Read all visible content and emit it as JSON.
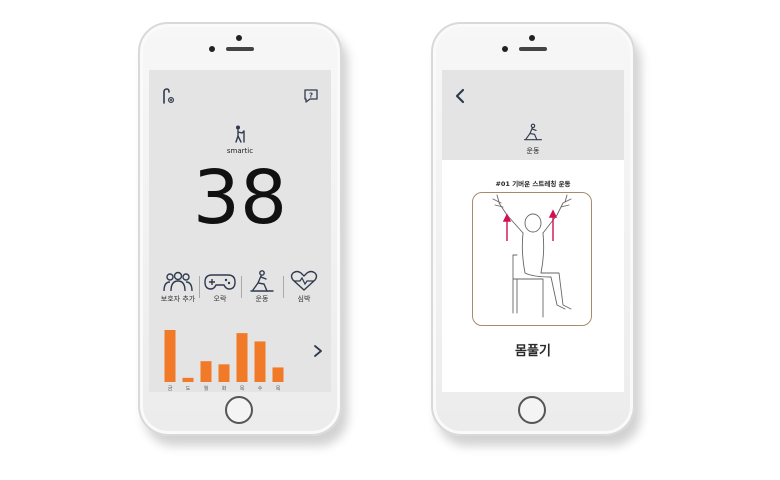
{
  "left_screen": {
    "brand_label": "smartic",
    "main_value": "38",
    "menu": [
      {
        "label": "보호자 추가",
        "icon": "people-icon"
      },
      {
        "label": "오락",
        "icon": "gamepad-icon"
      },
      {
        "label": "운동",
        "icon": "exercise-icon"
      },
      {
        "label": "심박",
        "icon": "heart-rate-icon"
      }
    ],
    "chart_data": {
      "type": "bar",
      "categories": [
        "금",
        "도",
        "월",
        "화",
        "목",
        "수",
        "목"
      ],
      "values": [
        100,
        8,
        40,
        34,
        94,
        78,
        28
      ],
      "ylim": [
        0,
        100
      ],
      "bar_color": "#f07a28"
    }
  },
  "right_screen": {
    "header_label": "운동",
    "exercise_title": "#01 기버운 스트레칭 운동",
    "exercise_caption": "몸풀기",
    "accent_arrow_color": "#d01050"
  }
}
